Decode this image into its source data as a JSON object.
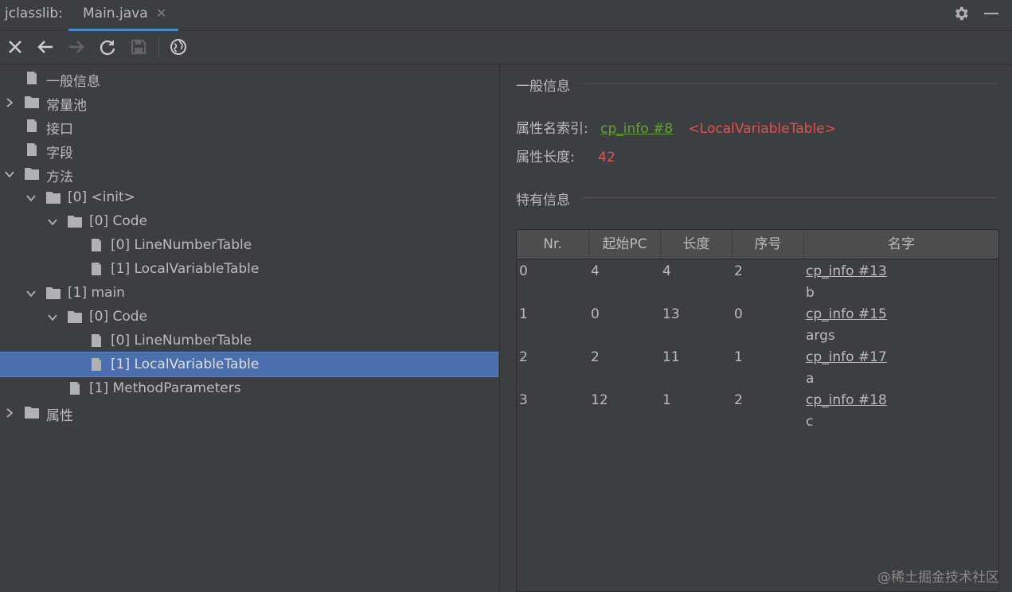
{
  "tab_bar": {
    "app_label": "jclasslib:",
    "tab_title": "Main.java",
    "close_glyph": "✕",
    "settings_icon": "gear-icon",
    "minimize_icon": "minimize-icon"
  },
  "toolbar": {
    "icons": [
      "close-icon",
      "back-icon",
      "forward-icon",
      "refresh-icon",
      "save-icon",
      "globe-icon"
    ]
  },
  "tree": {
    "items": [
      {
        "label": "一般信息"
      },
      {
        "label": "常量池"
      },
      {
        "label": "接口"
      },
      {
        "label": "字段"
      },
      {
        "label": "方法"
      },
      {
        "label": "[0] <init>"
      },
      {
        "label": "[0] Code"
      },
      {
        "label": "[0] LineNumberTable"
      },
      {
        "label": "[1] LocalVariableTable"
      },
      {
        "label": "[1] main"
      },
      {
        "label": "[0] Code"
      },
      {
        "label": "[0] LineNumberTable"
      },
      {
        "label": "[1] LocalVariableTable"
      },
      {
        "label": "[1] MethodParameters"
      },
      {
        "label": "属性"
      }
    ],
    "selected_label": "[1] LocalVariableTable"
  },
  "general": {
    "title": "一般信息",
    "name_index_label": "属性名索引:",
    "name_index_link": "cp_info #8",
    "name_index_value": "<LocalVariableTable>",
    "length_label": "属性长度:",
    "length_value": "42"
  },
  "specific": {
    "title": "特有信息",
    "columns": [
      "Nr.",
      "起始PC",
      "长度",
      "序号",
      "名字"
    ],
    "rows": [
      {
        "nr": "0",
        "start_pc": "4",
        "length": "4",
        "index": "2",
        "name_link": "cp_info #13",
        "name": "b"
      },
      {
        "nr": "1",
        "start_pc": "0",
        "length": "13",
        "index": "0",
        "name_link": "cp_info #15",
        "name": "args"
      },
      {
        "nr": "2",
        "start_pc": "2",
        "length": "11",
        "index": "1",
        "name_link": "cp_info #17",
        "name": "a"
      },
      {
        "nr": "3",
        "start_pc": "12",
        "length": "1",
        "index": "2",
        "name_link": "cp_info #18",
        "name": "c"
      }
    ]
  },
  "watermark": "@稀土掘金技术社区",
  "colors": {
    "background": "#3c3f41",
    "selection": "#4b6eaf",
    "link": "#6a9f38",
    "value_red": "#e05252",
    "tab_underline": "#4a88c7"
  }
}
